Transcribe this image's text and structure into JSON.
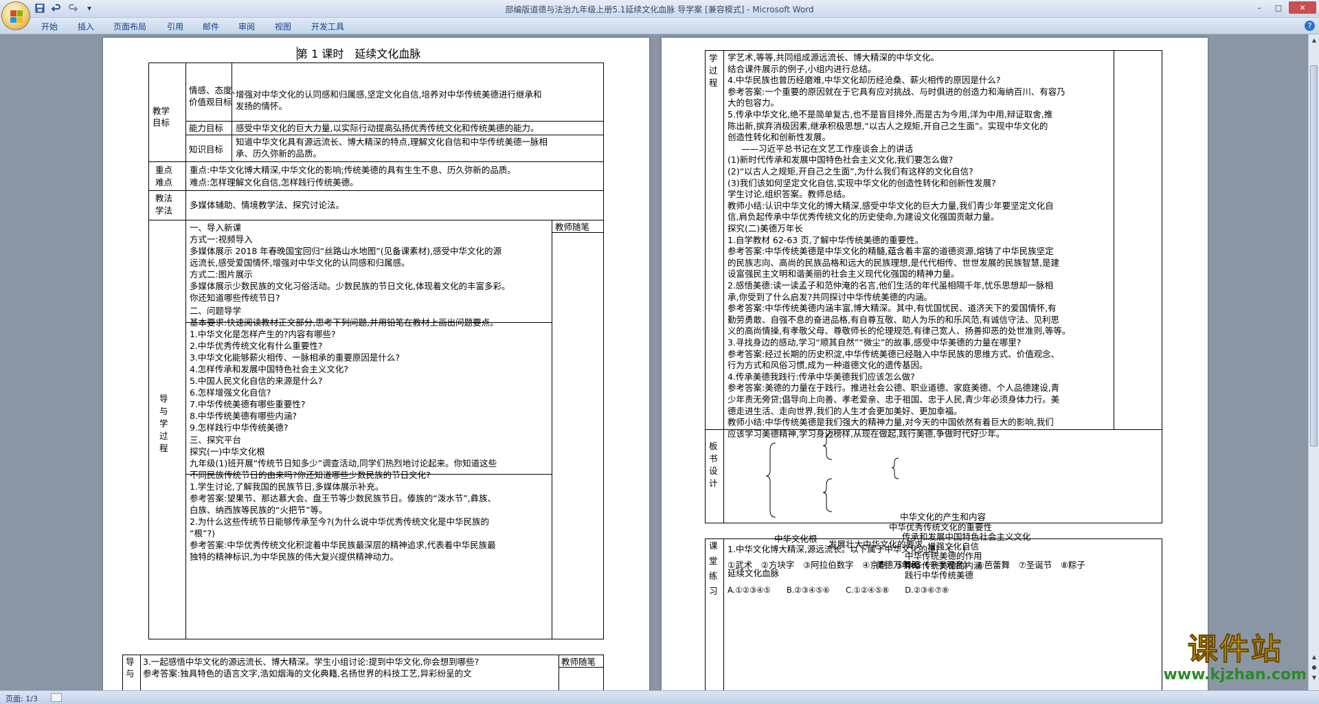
{
  "window": {
    "title": "部编版道德与法治九年级上册5.1延续文化血脉 导学案 [兼容模式] - Microsoft Word",
    "controls": {
      "minimize": "–",
      "maximize": "□",
      "close": "✕"
    }
  },
  "qat": {
    "save_icon": "save-icon",
    "undo_icon": "undo-icon",
    "redo_icon": "redo-icon",
    "customize": "▾"
  },
  "ribbon": {
    "tabs": [
      "开始",
      "插入",
      "页面布局",
      "引用",
      "邮件",
      "审阅",
      "视图",
      "开发工具"
    ],
    "help": "?"
  },
  "status": {
    "page": "页面: 1/3"
  },
  "watermark": {
    "main": "课件站",
    "url": "www.kjzhan.com"
  },
  "page1": {
    "title": "第 1 课时　延续文化血脉",
    "goals": {
      "label": [
        "教学",
        "目标"
      ],
      "rows": [
        {
          "label": [
            "情感、态度、",
            "价值观目标"
          ],
          "text": [
            "增强对中华文化的认同感和归属感,坚定文化自信,培养对中华传统美德进行继承和",
            "发扬的情怀。"
          ]
        },
        {
          "label": [
            "能力目标"
          ],
          "text": [
            "感受中华文化的巨大力量,以实际行动提高弘扬优秀传统文化和传统美德的能力。"
          ]
        },
        {
          "label": [
            "知识目标"
          ],
          "text": [
            "知道中华文化具有源远流长、博大精深的特点,理解文化自信和中华传统美德一脉相",
            "承、历久弥新的品质。"
          ]
        }
      ]
    },
    "keypoints": {
      "label": [
        "重点",
        "难点"
      ],
      "lines": [
        "重点:中华文化博大精深,中华文化的影响;传统美德的具有生生不息、历久弥新的品质。",
        "难点:怎样理解文化自信,怎样践行传统美德。"
      ]
    },
    "methods": {
      "label": [
        "教法",
        "学法"
      ],
      "text": "多媒体辅助、情境教学法、探究讨论法。"
    },
    "process": {
      "label": [
        "导",
        "与",
        "学",
        "过",
        "程"
      ],
      "notes_header": "教师随笔",
      "section1": [
        "一、导入新课",
        "方式一:视频导入",
        "多媒体展示 2018 年春晚国宝回归“丝路山水地图”(见备课素材),感受中华文化的源",
        "远流长,感受爱国情怀,增强对中华文化的认同感和归属感。",
        "方式二:图片展示",
        "多媒体展示少数民族的文化习俗活动。少数民族的节日文化,体现着文化的丰富多彩。",
        "你还知道哪些传统节日?"
      ],
      "section2": [
        "二、问题导学",
        "基本要求:快速阅读教材正文部分,思考下列问题,并用铅笔在教材上画出问题要点。",
        "1.中华文化是怎样产生的?内容有哪些?",
        "2.中华优秀传统文化有什么重要性?",
        "3.中华文化能够薪火相传、一脉相承的重要原因是什么?",
        "4.怎样传承和发展中国特色社会主义文化?",
        "5.中国人民文化自信的来源是什么?",
        "6.怎样增强文化自信?",
        "7.中华传统美德有哪些重要性?",
        "8.中华传统美德有哪些内涵?",
        "9.怎样践行中华传统美德?"
      ],
      "section3": [
        "三、探究平台",
        "探究(一)中华文化根",
        "九年级(1)班开展“传统节日知多少”调查活动,同学们热烈地讨论起来。你知道这些",
        "不同民族传统节日的由来吗?你还知道哪些少数民族的节日文化?",
        "1.学生讨论,了解我国的民族节日,多媒体展示补充。",
        "参考答案:望果节、那达慕大会、盘王节等少数民族节日。傣族的“泼水节”,彝族、",
        "白族、纳西族等民族的“火把节”等。",
        "2.为什么这些传统节日能够传承至今?(为什么说中华优秀传统文化是中华民族的",
        "“根”?)",
        "参考答案:中华优秀传统文化积淀着中华民族最深层的精神追求,代表着中华民族最",
        "独特的精神标识,为中华民族的伟大复兴提供精神动力。"
      ]
    },
    "bottom": {
      "label": [
        "导",
        "与"
      ],
      "lines": [
        "3.一起感悟中华文化的源远流长、博大精深。学生小组讨论:提到中华文化,你会想到哪些?",
        "参考答案:独具特色的语言文字,浩如烟海的文化典籍,名扬世界的科技工艺,异彩纷呈的文"
      ],
      "notes_header": "教师随笔"
    }
  },
  "page2": {
    "process": {
      "label": [
        "学",
        "过",
        "程"
      ],
      "lines": [
        "学艺术,等等,共同组成源远流长、博大精深的中华文化。",
        "结合课件展示的例子,小组内进行总结。",
        "4.中华民族也曾历经磨难,中华文化却历经沧桑、薪火相传的原因是什么?",
        "参考答案:一个重要的原因就在于它具有应对挑战、与时俱进的创造力和海纳百川、有容乃",
        "大的包容力。",
        "5.传承中华文化,绝不是简单复古,也不是盲目排外,而是古为今用,洋为中用,辩证取舍,推",
        "陈出新,摈弃消极因素,继承积极思想,“以古人之规矩,开自己之生面”。实现中华文化的",
        "创造性转化和创新性发展。",
        "——习近平总书记在文艺工作座谈会上的讲话",
        "(1)新时代传承和发展中国特色社会主义文化,我们要怎么做?",
        "(2)“以古人之规矩,开自己之生面”,为什么我们有这样的文化自信?",
        "(3)我们该如何坚定文化自信,实现中华文化的创造性转化和创新性发展?",
        "学生讨论,组织答案。教师总结。",
        "教师小结:认识中华文化的博大精深,感受中华文化的巨大力量,我们青少年要坚定文化自",
        "信,肩负起传承中华优秀传统文化的历史使命,为建设文化强国贡献力量。",
        "探究(二)美德万年长",
        "1.自学教材 62-63 页,了解中华传统美德的重要性。",
        "参考答案:中华传统美德是中华文化的精髓,蕴含着丰富的道德资源,熔铸了中华民族坚定",
        "的民族志向、高尚的民族品格和远大的民族理想,是代代相传、世世发展的民族智慧,是建",
        "设富强民主文明和谐美丽的社会主义现代化强国的精神力量。",
        "2.感悟美德:读一读孟子和范仲淹的名言,他们生活的年代虽相隔千年,忧乐思想却一脉相",
        "承,你受到了什么启发?共同探讨中华传统美德的内涵。",
        "参考答案:中华传统美德内涵丰富,博大精深。其中,有忧国忧民、道济天下的爱国情怀,有",
        "勤劳勇敢、自强不息的奋进品格,有自尊互敬、助人为乐的和乐风范,有诚信守法、见利思",
        "义的高尚情操,有孝敬父母、尊敬师长的伦理规范,有律己宽人、扬善抑恶的处世准则,等等。",
        "3.寻找身边的感动,学习“顺其自然”“微尘”的故事,感受中华美德的力量在哪里?",
        "参考答案:经过长期的历史积淀,中华传统美德已经融入中华民族的思维方式、价值观念、",
        "行为方式和风俗习惯,成为一种道德文化的遗传基因。",
        "4.传承美德我践行:传承中华美德我们应该怎么做?",
        "参考答案:美德的力量在于践行。推进社会公德、职业道德、家庭美德、个人品德建设,青",
        "少年责无旁贷;倡导向上向善、孝老爱亲、忠于祖国、忠于人民,青少年必须身体力行。美",
        "德走进生活、走向世界,我们的人生才会更加美好、更加幸福。",
        "教师小结:中华传统美德是我们强大的精神力量,对今天的中国依然有着巨大的影响,我们",
        "应该学习美德精神,学习身边榜样,从现在做起,践行美德,争做时代好少年。"
      ]
    },
    "board": {
      "label": [
        "板",
        "书",
        "设",
        "计"
      ],
      "root": "延续文化血脉",
      "branch1": "中华文化根",
      "branch1a": "发展壮大中华文化的要求",
      "branch2": "美德万年长",
      "leaves1": [
        "中华文化的产生和内容",
        "中华优秀传统文化的重要性"
      ],
      "leaves1a": [
        "传承和发展中国特色社会主义文化",
        "增强文化自信"
      ],
      "leaves2": [
        "中华传统美德的作用",
        "中华传统美德的内涵",
        "践行中华传统美德"
      ]
    },
    "practice": {
      "label": [
        "课",
        "堂",
        "练",
        "习"
      ],
      "question": "1.中华文化博大精深,源远流长。以下属于中华文化的是(　C　)",
      "items": "①武术　②方块字　③阿拉伯数字　④京剧　⑤舞蹈《千手观音》　⑥芭蕾舞　⑦圣诞节　⑧粽子",
      "options": "A.①②③④⑤　　B.②③④⑤⑥　　C.①②④⑤⑧　　D.②③⑥⑦⑧"
    }
  }
}
